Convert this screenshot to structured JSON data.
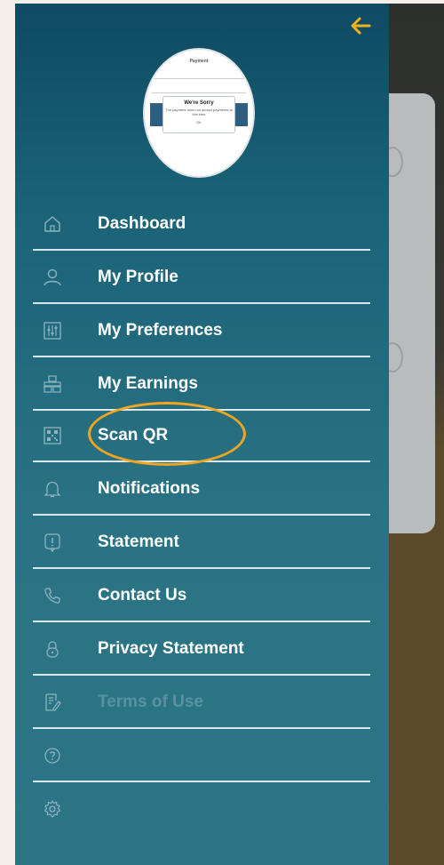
{
  "drawer": {
    "menu_items": [
      {
        "label": "Dashboard",
        "icon": "home-icon"
      },
      {
        "label": "My Profile",
        "icon": "user-icon"
      },
      {
        "label": "My Preferences",
        "icon": "sliders-icon"
      },
      {
        "label": "My Earnings",
        "icon": "money-icon"
      },
      {
        "label": "Scan QR",
        "icon": "qr-code-icon"
      },
      {
        "label": "Notifications",
        "icon": "bell-icon"
      },
      {
        "label": "Statement",
        "icon": "statement-icon"
      },
      {
        "label": "Contact Us",
        "icon": "phone-icon"
      },
      {
        "label": "Privacy Statement",
        "icon": "lock-icon"
      },
      {
        "label": "Terms of Use",
        "icon": "document-edit-icon"
      },
      {
        "label": "",
        "icon": "help-icon"
      },
      {
        "label": "",
        "icon": "settings-icon"
      }
    ]
  },
  "avatar_preview": {
    "title": "Payment",
    "dialog_title": "We're Sorry",
    "dialog_message": "The payment does not accept payments at this time",
    "dialog_button": "OK"
  },
  "colors": {
    "drawer_top": "#0f4a62",
    "drawer_bottom": "#2b7585",
    "highlight": "#f3a51e",
    "back_arrow": "#f3b21e"
  }
}
